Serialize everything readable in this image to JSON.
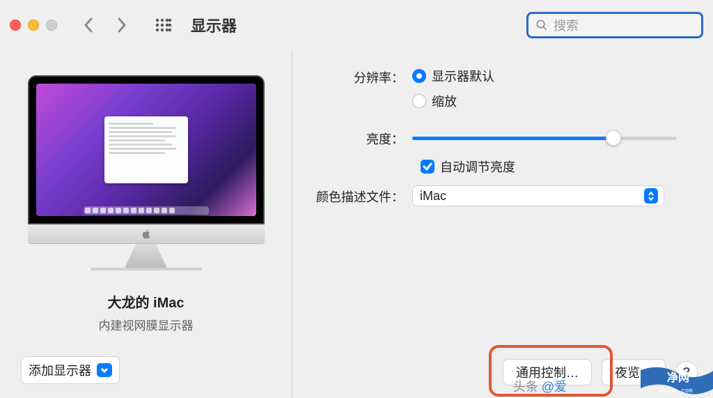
{
  "header": {
    "title": "显示器",
    "search_placeholder": "搜索"
  },
  "left": {
    "device_name": "大龙的 iMac",
    "device_sub": "内建视网膜显示器",
    "add_display": "添加显示器"
  },
  "settings": {
    "resolution": {
      "label": "分辨率：",
      "option_default": "显示器默认",
      "option_scaled": "缩放",
      "selected": "default"
    },
    "brightness": {
      "label": "亮度：",
      "value_percent": 76
    },
    "auto_brightness": {
      "label": "自动调节亮度",
      "checked": true
    },
    "color_profile": {
      "label": "颜色描述文件：",
      "value": "iMac"
    }
  },
  "buttons": {
    "universal_control": "通用控制…",
    "night_shift": "夜览…",
    "help": "?"
  },
  "watermarks": {
    "line1_a": "头条",
    "line1_b": "@爱",
    "badge_text": "净网",
    "badge_url": "xajjn.com"
  }
}
